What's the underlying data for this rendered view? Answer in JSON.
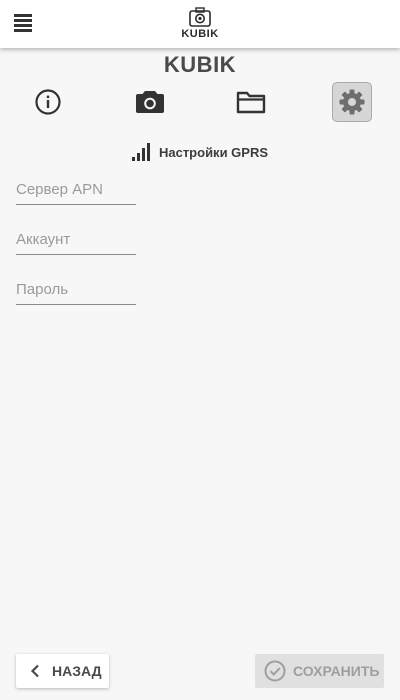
{
  "header": {
    "logo_text": "KUBIK",
    "menu_icon": "hamburger-menu-icon"
  },
  "page": {
    "title": "KUBIK"
  },
  "nav": [
    {
      "icon": "info-icon",
      "active": false
    },
    {
      "icon": "camera-icon",
      "active": false
    },
    {
      "icon": "folder-icon",
      "active": false
    },
    {
      "icon": "gear-icon",
      "active": true
    }
  ],
  "section": {
    "icon": "signal-bars-icon",
    "title": "Настройки GPRS"
  },
  "form": {
    "apn_placeholder": "Сервер APN",
    "apn_value": "",
    "account_placeholder": "Аккаунт",
    "account_value": "",
    "password_placeholder": "Пароль",
    "password_value": ""
  },
  "footer": {
    "back_label": "НАЗАД",
    "save_label": "СОХРАНИТЬ",
    "save_disabled": true
  },
  "colors": {
    "background": "#f7f7f7",
    "topbar": "#ffffff",
    "active_tab": "#d6d6d6",
    "text": "#4a4a4a",
    "disabled_text": "#9e9e9e"
  }
}
